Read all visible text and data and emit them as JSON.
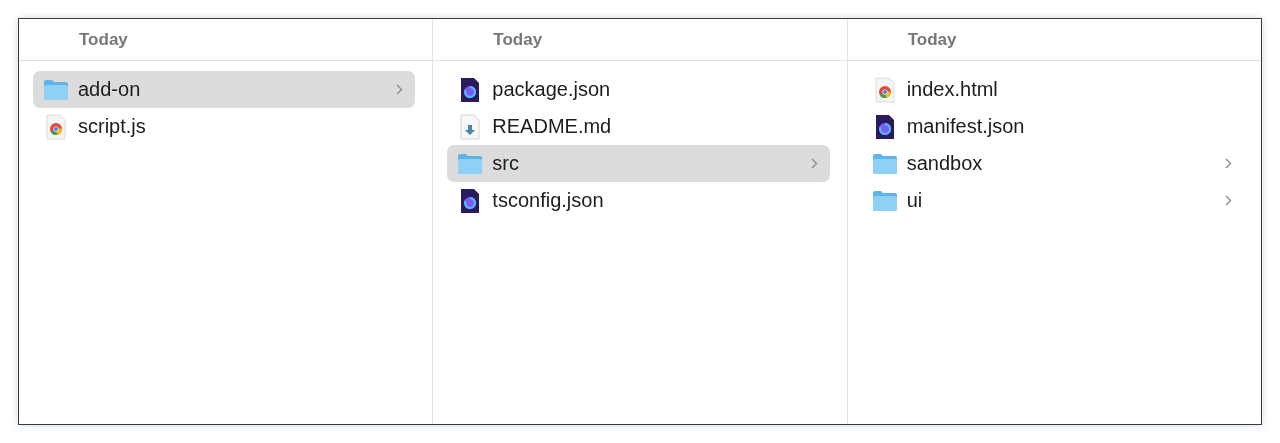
{
  "columns": [
    {
      "header": "Today",
      "items": [
        {
          "name": "add-on",
          "kind": "folder",
          "selected": true
        },
        {
          "name": "script.js",
          "kind": "chrome-doc",
          "selected": false
        }
      ]
    },
    {
      "header": "Today",
      "items": [
        {
          "name": "package.json",
          "kind": "firefox-doc",
          "selected": false
        },
        {
          "name": "README.md",
          "kind": "download-doc",
          "selected": false
        },
        {
          "name": "src",
          "kind": "folder",
          "selected": true
        },
        {
          "name": "tsconfig.json",
          "kind": "firefox-doc",
          "selected": false
        }
      ]
    },
    {
      "header": "Today",
      "items": [
        {
          "name": "index.html",
          "kind": "chrome-doc",
          "selected": false
        },
        {
          "name": "manifest.json",
          "kind": "firefox-doc",
          "selected": false
        },
        {
          "name": "sandbox",
          "kind": "folder",
          "selected": false
        },
        {
          "name": "ui",
          "kind": "folder",
          "selected": false
        }
      ]
    }
  ]
}
